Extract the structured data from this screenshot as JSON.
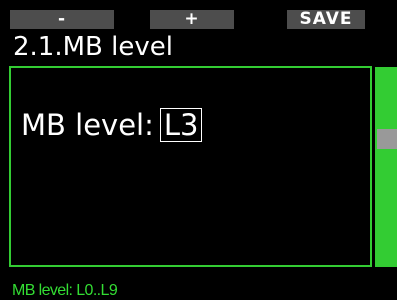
{
  "softkeys": {
    "left_label": "-",
    "middle_label": "+",
    "right_label": "SAVE"
  },
  "screen": {
    "title": "2.1.MB level"
  },
  "setting": {
    "label": "MB level:",
    "value": "L3"
  },
  "scrollbar": {
    "position_fraction": 0.3
  },
  "footer": {
    "hint": "MB level: L0..L9"
  },
  "colors": {
    "accent": "#33cc33",
    "background": "#000000",
    "softkey_bg": "#4d4d4d",
    "scroll_thumb": "#999999",
    "text": "#ffffff"
  }
}
